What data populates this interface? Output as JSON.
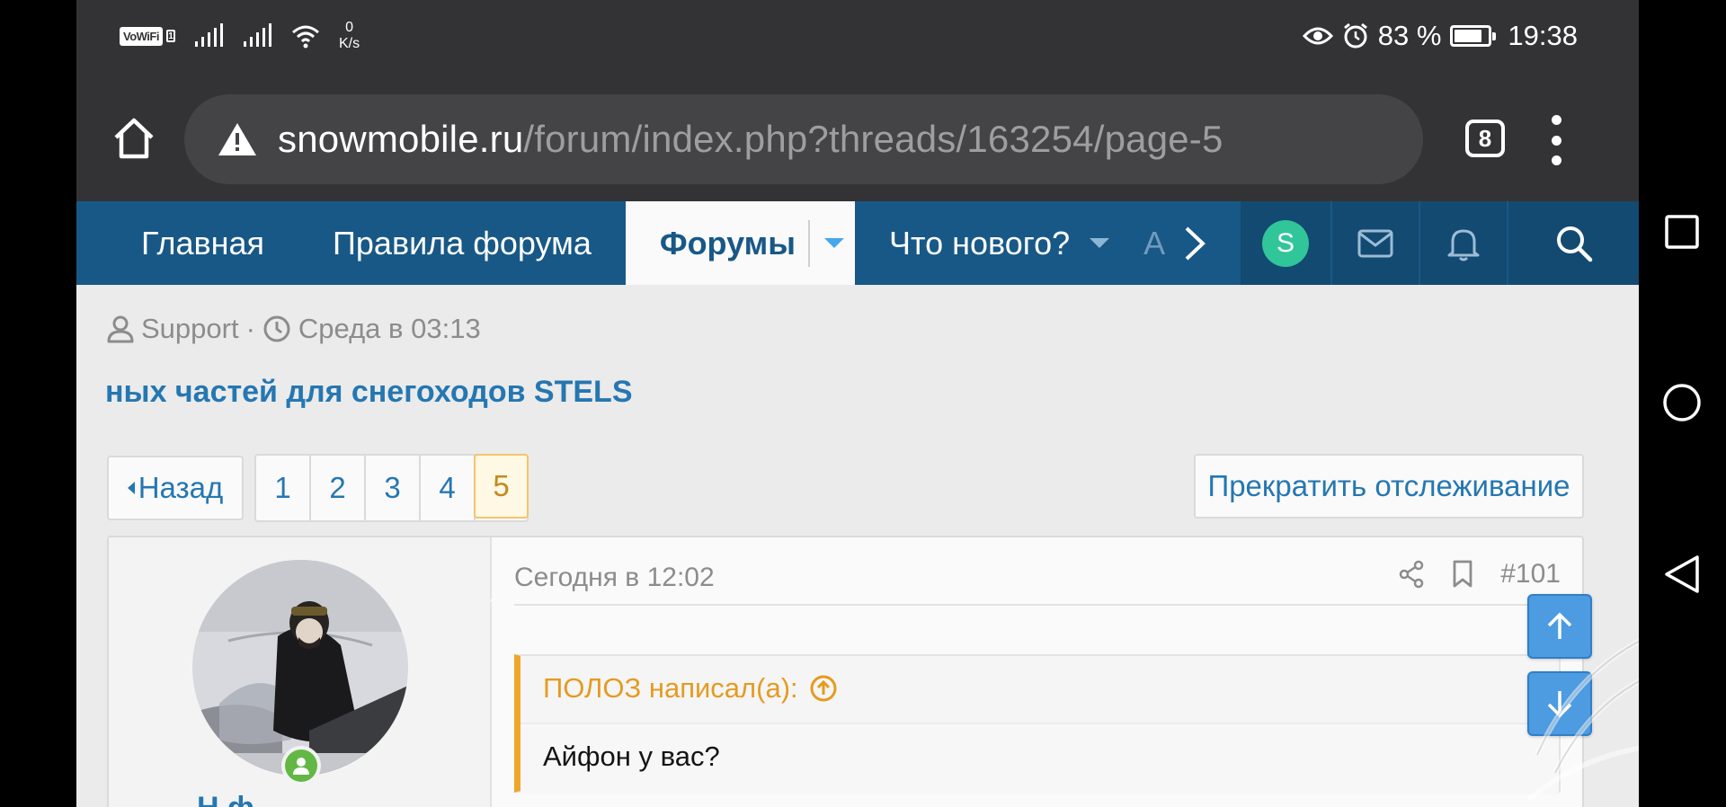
{
  "status_bar": {
    "vowifi_label": "VoWiFi",
    "sim_label": "1",
    "net_speed_value": "0",
    "net_speed_unit": "K/s",
    "battery_percent": "83 %",
    "battery_level": 0.83,
    "time": "19:38"
  },
  "browser": {
    "url_domain": "snowmobile.ru",
    "url_path": "/forum/index.php?threads/163254/page-5",
    "tab_count": "8"
  },
  "forum_nav": {
    "items": [
      {
        "label": "Главная"
      },
      {
        "label": "Правила форума"
      },
      {
        "label": "Форумы"
      },
      {
        "label": "Что нового?"
      }
    ],
    "more_label": "А",
    "user_initial": "S"
  },
  "thread": {
    "author": "Support",
    "separator": "·",
    "date": "Среда в 03:13",
    "title": "ных частей для снегоходов STELS"
  },
  "pagination": {
    "back_label": "Назад",
    "pages": [
      "1",
      "2",
      "3",
      "4",
      "5"
    ],
    "current": "5"
  },
  "watch_button": "Прекратить отслеживание",
  "post": {
    "date": "Сегодня в 12:02",
    "number": "#101",
    "username_partial": "Н       ф",
    "quote_author": "ПОЛОЗ написал(а):",
    "quote_text": "Айфон у вас?"
  },
  "colors": {
    "nav_bg": "#185886",
    "link": "#2577b1",
    "quote_accent": "#f0a62c",
    "online": "#63b745",
    "user_avatar": "#31c59a"
  }
}
